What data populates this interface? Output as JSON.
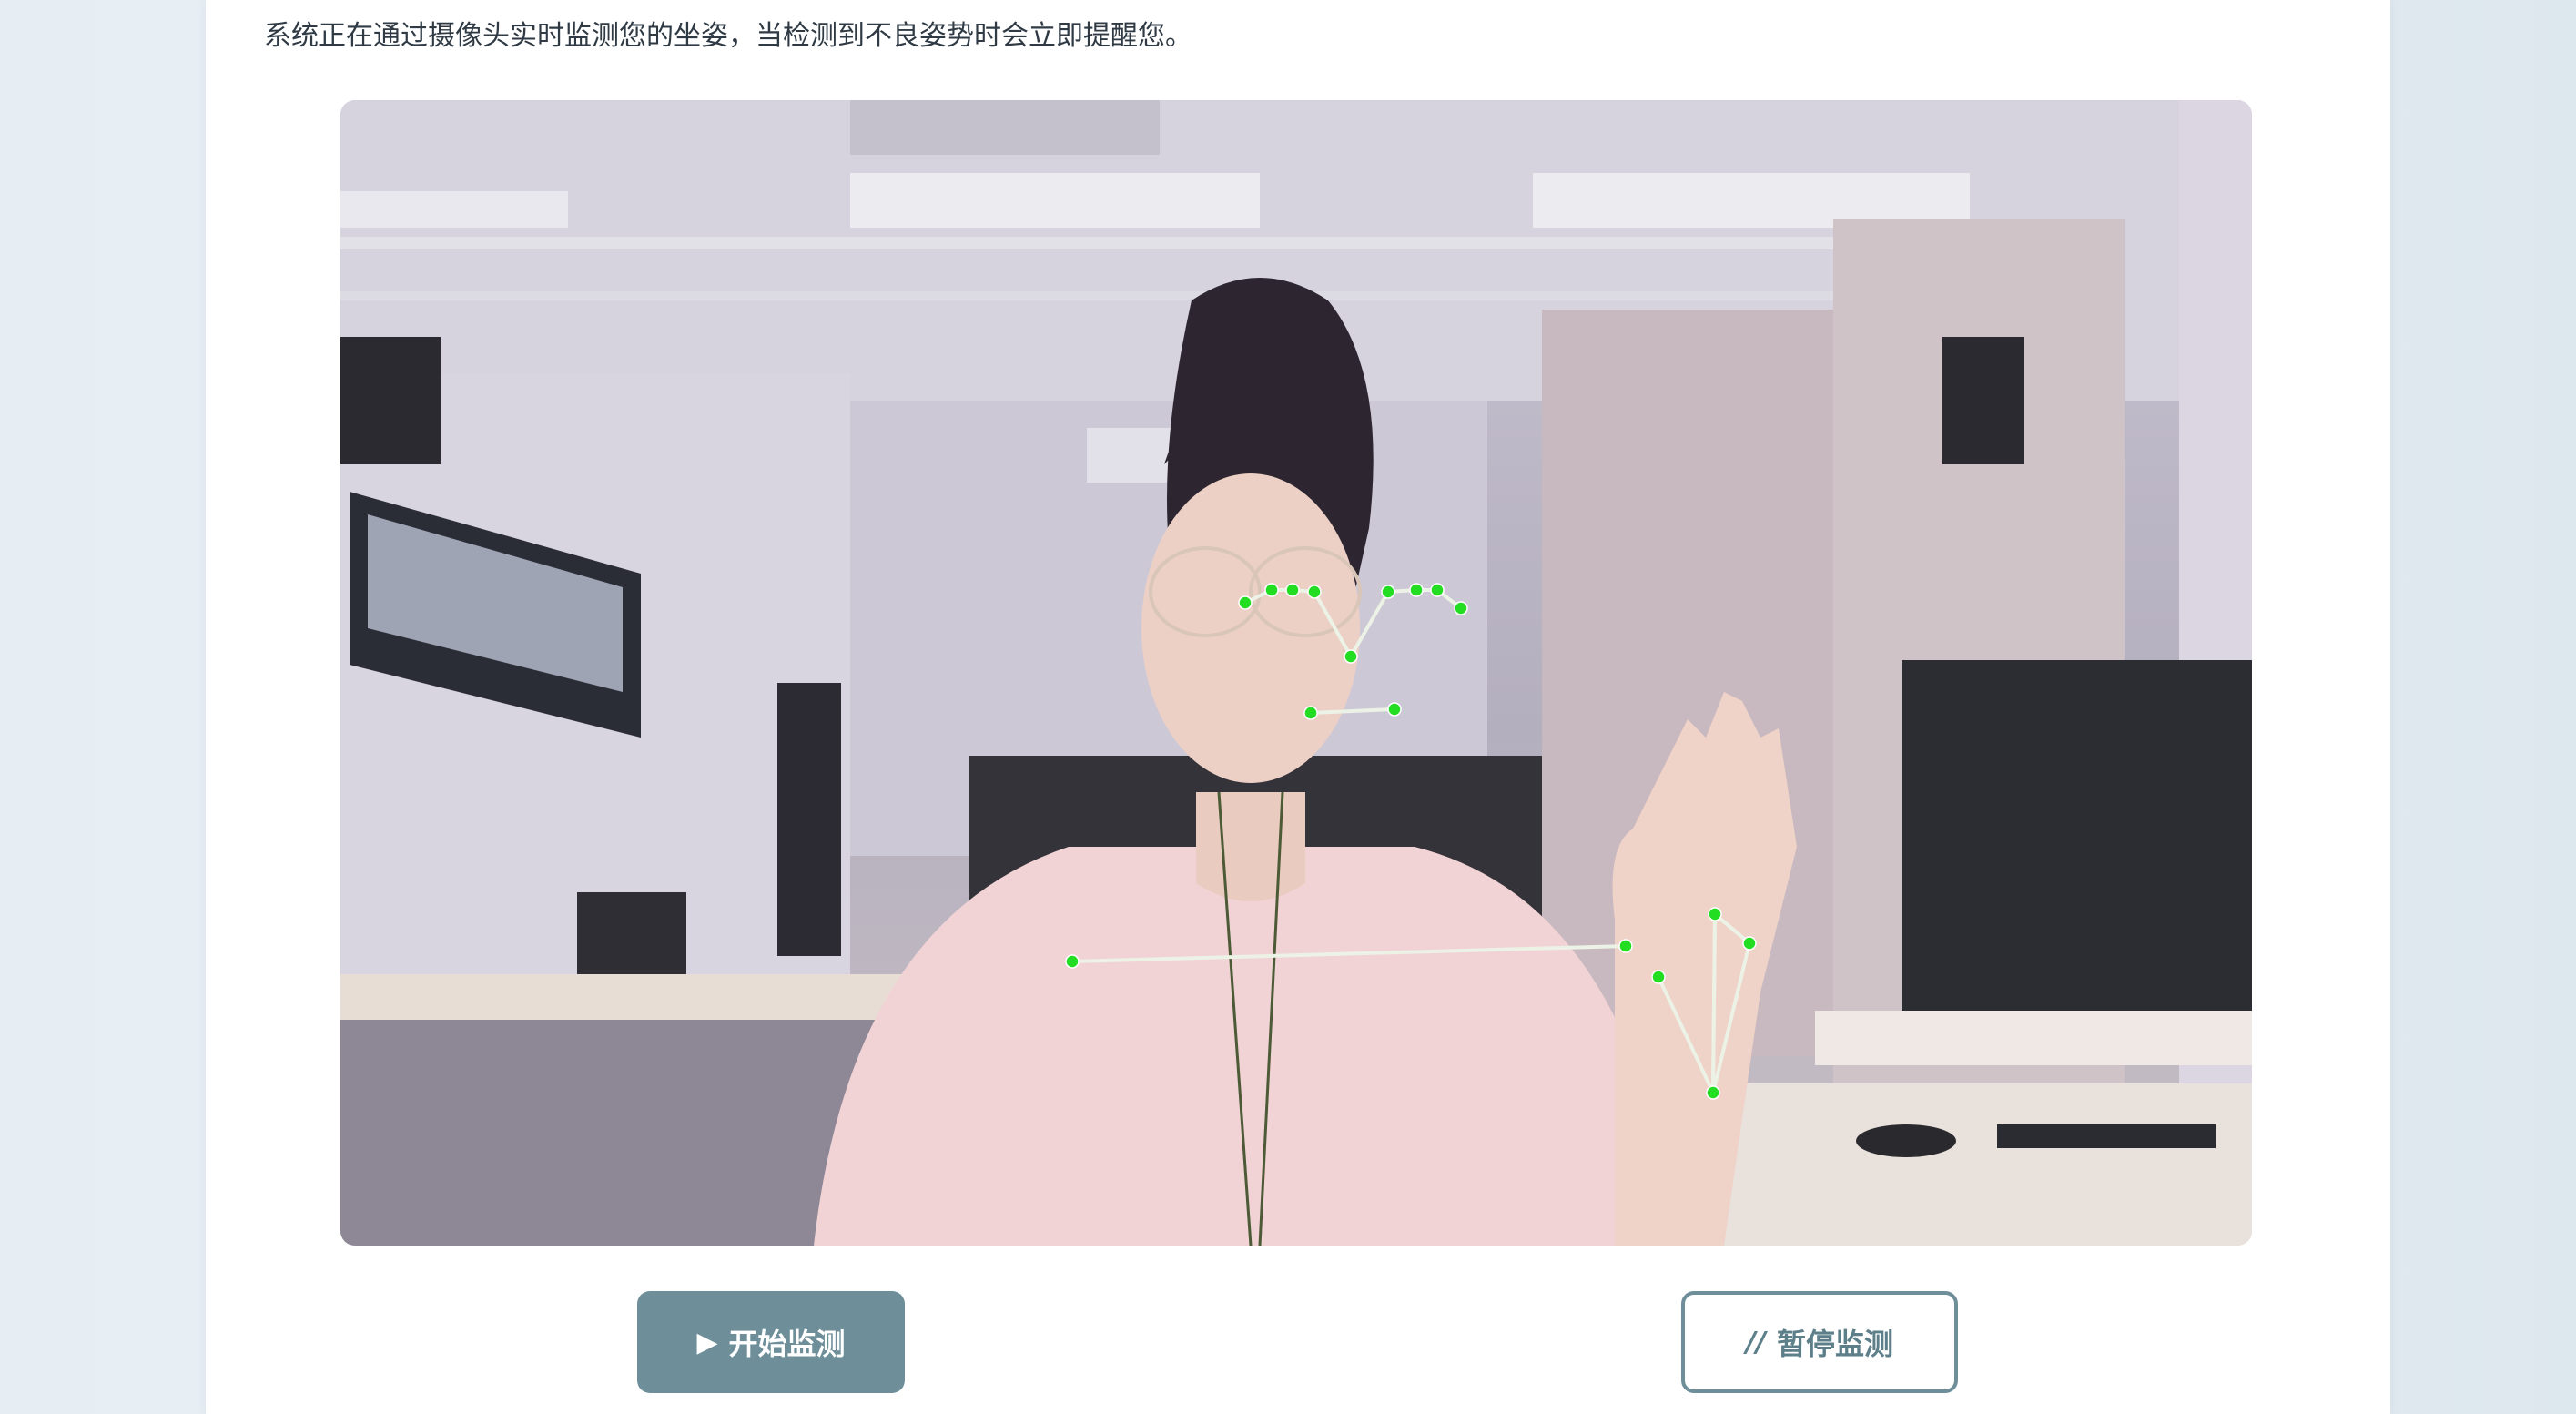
{
  "description": "系统正在通过摄像头实时监测您的坐姿，当检测到不良姿势时会立即提醒您。",
  "controls": {
    "start_icon": "▶",
    "start_label": "开始监测",
    "pause_icon": "//",
    "pause_label": "暂停监测"
  },
  "colors": {
    "accent": "#6e8f9a",
    "landmark": "#22dd22",
    "skeleton": "#e8f0e0"
  },
  "icons": [
    "play-icon",
    "pause-icon"
  ]
}
